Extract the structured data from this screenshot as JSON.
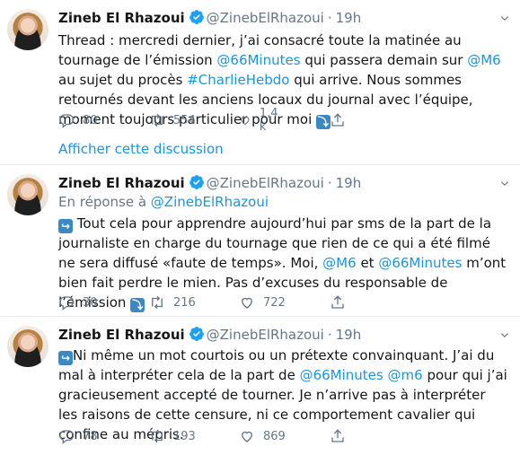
{
  "tweets": [
    {
      "name": "Zineb El Rhazoui",
      "handle": "@ZinebElRhazoui",
      "time": "19h",
      "reply_prefix": "",
      "reply_handle": "",
      "text_parts": [
        {
          "t": "Thread : mercredi dernier, j’ai consacré toute la matinée au tournage de l’émission ",
          "link": false
        },
        {
          "t": "@66Minutes",
          "link": true
        },
        {
          "t": " qui passera demain sur ",
          "link": false
        },
        {
          "t": "@M6",
          "link": true
        },
        {
          "t": " au sujet du procès ",
          "link": false
        },
        {
          "t": "#CharlieHebdo",
          "link": true
        },
        {
          "t": " qui arrive. Nous sommes retournés devant les anciens locaux du journal avec l’équipe, moment toujours particulier pour moi ",
          "link": false
        }
      ],
      "trailing_emoji": "⤵",
      "leading_emoji": "",
      "replies": "80",
      "retweets": "554",
      "likes": "1,4 k",
      "show_thread": "Afficher cette discussion"
    },
    {
      "name": "Zineb El Rhazoui",
      "handle": "@ZinebElRhazoui",
      "time": "19h",
      "reply_prefix": "En réponse à ",
      "reply_handle": "@ZinebElRhazoui",
      "leading_emoji": "↪",
      "text_parts": [
        {
          "t": " Tout cela pour apprendre aujourd’hui par sms de la part de la journaliste en charge du tournage que rien de ce qui a été filmé ne sera diffusé «faute de temps». Moi, ",
          "link": false
        },
        {
          "t": "@M6",
          "link": true
        },
        {
          "t": " et ",
          "link": false
        },
        {
          "t": "@66Minutes",
          "link": true
        },
        {
          "t": " m’ont bien fait perdre le mien. Pas d’excuses du responsable de l’émission ",
          "link": false
        }
      ],
      "trailing_emoji": "⤵",
      "replies": "30",
      "retweets": "216",
      "likes": "722"
    },
    {
      "name": "Zineb El Rhazoui",
      "handle": "@ZinebElRhazoui",
      "time": "19h",
      "leading_emoji": "↪",
      "text_parts": [
        {
          "t": "Ni même un mot courtois ou un prétexte convainquant. J’ai du mal à interpréter cela de la part de ",
          "link": false
        },
        {
          "t": "@66Minutes",
          "link": true
        },
        {
          "t": " ",
          "link": false
        },
        {
          "t": "@m6",
          "link": true
        },
        {
          "t": " pour qui j’ai gracieusement accepté de tourner. Je n’arrive pas à interpréter les raisons de cette censure, ni ce comportement cavalier qui confine au mépris.",
          "link": false
        }
      ],
      "trailing_emoji": "",
      "replies": "78",
      "retweets": "193",
      "likes": "869"
    }
  ],
  "colors": {
    "link": "#1b95e0",
    "muted": "#657786",
    "divider": "#e6ecf0",
    "verified": "#1da1f2"
  }
}
